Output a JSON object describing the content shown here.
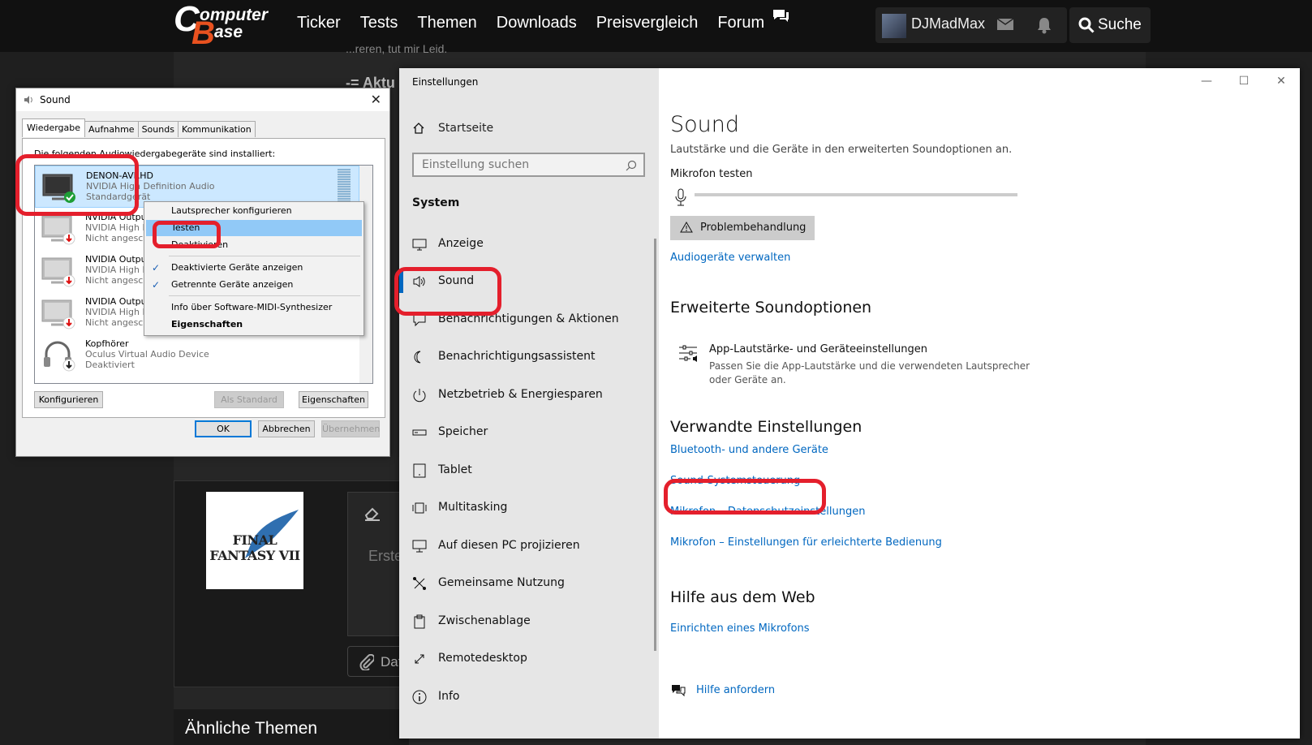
{
  "site": {
    "logo_line1": "omputer",
    "logo_line2": "ase",
    "nav": [
      "Ticker",
      "Tests",
      "Themen",
      "Downloads",
      "Preisvergleich",
      "Forum"
    ],
    "username": "DJMadMax",
    "search_label": "Suche",
    "bg_text_1": "...reren, tut mir Leid.",
    "bg_text_2": "-= Aktu",
    "avatar_text": "FINAL FANTASY VII",
    "editor_placeholder": "Erste",
    "attach_label": "Dat",
    "similar_title": "Ähnliche Themen"
  },
  "settings": {
    "window_title": "Einstellungen",
    "controls": {
      "minimize": "—",
      "maximize": "☐",
      "close": "✕"
    },
    "home": "Startseite",
    "search_placeholder": "Einstellung suchen",
    "section": "System",
    "nav": [
      {
        "label": "Anzeige",
        "icon": "display-icon"
      },
      {
        "label": "Sound",
        "icon": "speaker-icon",
        "active": true
      },
      {
        "label": "Benachrichtigungen & Aktionen",
        "icon": "notification-icon"
      },
      {
        "label": "Benachrichtigungsassistent",
        "icon": "moon-icon"
      },
      {
        "label": "Netzbetrieb & Energiesparen",
        "icon": "power-icon"
      },
      {
        "label": "Speicher",
        "icon": "storage-icon"
      },
      {
        "label": "Tablet",
        "icon": "tablet-icon"
      },
      {
        "label": "Multitasking",
        "icon": "multitasking-icon"
      },
      {
        "label": "Auf diesen PC projizieren",
        "icon": "project-icon"
      },
      {
        "label": "Gemeinsame Nutzung",
        "icon": "share-icon"
      },
      {
        "label": "Zwischenablage",
        "icon": "clipboard-icon"
      },
      {
        "label": "Remotedesktop",
        "icon": "remote-icon"
      },
      {
        "label": "Info",
        "icon": "info-icon"
      }
    ],
    "page_title": "Sound",
    "page_subtitle": "Lautstärke und die Geräte in den erweiterten Soundoptionen an.",
    "mic_test_label": "Mikrofon testen",
    "troubleshoot_label": "Problembehandlung",
    "manage_devices_link": "Audiogeräte verwalten",
    "advanced_heading": "Erweiterte Soundoptionen",
    "app_volume_title": "App-Lautstärke- und Geräteeinstellungen",
    "app_volume_desc": "Passen Sie die App-Lautstärke und die verwendeten Lautsprecher oder Geräte an.",
    "related_heading": "Verwandte Einstellungen",
    "related_links": [
      "Bluetooth- und andere Geräte",
      "Sound-Systemsteuerung",
      "Mikrofon – Datenschutzeinstellungen",
      "Mikrofon – Einstellungen für erleichterte Bedienung"
    ],
    "web_help_heading": "Hilfe aus dem Web",
    "web_help_link": "Einrichten eines Mikrofons",
    "get_help_link": "Hilfe anfordern"
  },
  "sound_dialog": {
    "title": "Sound",
    "close": "✕",
    "tabs": [
      "Wiedergabe",
      "Aufnahme",
      "Sounds",
      "Kommunikation"
    ],
    "intro": "Die folgenden Audiowiedergabegeräte sind installiert:",
    "devices": [
      {
        "name": "DENON-AVRHD",
        "sub": "NVIDIA High Definition Audio",
        "status": "Standardgerät",
        "state": "default"
      },
      {
        "name": "NVIDIA Output",
        "sub": "NVIDIA High D",
        "status": "Nicht angeschl",
        "state": "unplugged"
      },
      {
        "name": "NVIDIA Output",
        "sub": "NVIDIA High D",
        "status": "Nicht angeschl",
        "state": "unplugged"
      },
      {
        "name": "NVIDIA Output",
        "sub": "NVIDIA High D",
        "status": "Nicht angeschl",
        "state": "unplugged"
      },
      {
        "name": "Kopfhörer",
        "sub": "Oculus Virtual Audio Device",
        "status": "Deaktiviert",
        "state": "disabled"
      }
    ],
    "buttons": {
      "configure": "Konfigurieren",
      "set_default": "Als Standard",
      "properties": "Eigenschaften",
      "ok": "OK",
      "cancel": "Abbrechen",
      "apply": "Übernehmen"
    },
    "context_menu": [
      {
        "label": "Lautsprecher konfigurieren"
      },
      {
        "label": "Testen",
        "highlighted": true
      },
      {
        "label": "Deaktivieren"
      },
      {
        "label": "Deaktivierte Geräte anzeigen",
        "checked": true
      },
      {
        "label": "Getrennte Geräte anzeigen",
        "checked": true
      },
      {
        "label": "Info über Software-MIDI-Synthesizer"
      },
      {
        "label": "Eigenschaften",
        "bold": true
      }
    ],
    "check_mark": "✓"
  },
  "colors": {
    "accent": "#0067c0",
    "highlight_red": "#e41f2c",
    "cb_orange": "#e8511f"
  }
}
